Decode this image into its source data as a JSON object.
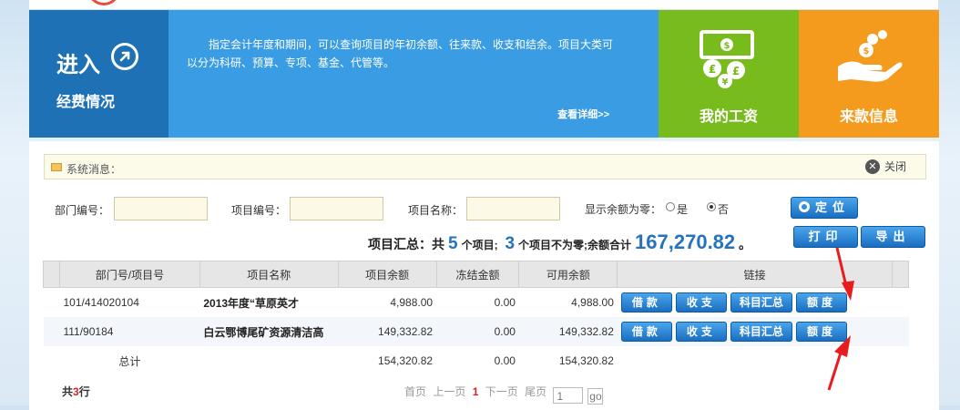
{
  "tiles": {
    "enter": {
      "title": "进入",
      "subtitle": "经费情况"
    },
    "info": {
      "description": "指定会计年度和期间，可以查询项目的年初余额、往来款、收支和结余。项目大类可以分为科研、预算、专项、基金、代管等。",
      "link": "查看详细>>"
    },
    "salary": {
      "label": "我的工资"
    },
    "income": {
      "label": "来款信息"
    }
  },
  "system_message": {
    "label": "系统消息：",
    "close_label": "关闭"
  },
  "filters": {
    "dept_label": "部门编号：",
    "dept_value": "",
    "project_no_label": "项目编号：",
    "project_no_value": "",
    "project_name_label": "项目名称：",
    "project_name_value": "",
    "zero_balance_label": "显示余额为零：",
    "option_yes": "是",
    "option_no": "否",
    "selected": "否",
    "locate_button": "定位"
  },
  "summary": {
    "prefix": "项目汇总：共",
    "project_count": "5",
    "count_unit": "个项目;",
    "nonzero_count": "3",
    "nonzero_text": "个项目不为零;余额合计",
    "balance_total": "167,270.82",
    "suffix": "。"
  },
  "actions": {
    "print": "打印",
    "export": "导出"
  },
  "table": {
    "headers": [
      "部门号/项目号",
      "项目名称",
      "项目余额",
      "冻结金额",
      "可用余额",
      "链接"
    ],
    "rows": [
      {
        "id": "101/414020104",
        "name": "2013年度“草原英才",
        "balance": "4,988.00",
        "frozen": "0.00",
        "available": "4,988.00"
      },
      {
        "id": "111/90184",
        "name": "白云鄂博尾矿资源清洁高",
        "balance": "149,332.82",
        "frozen": "0.00",
        "available": "149,332.82"
      }
    ],
    "row_buttons": [
      "借款",
      "收支",
      "科目汇总",
      "额度"
    ],
    "total": {
      "label": "总计",
      "balance": "154,320.82",
      "frozen": "0.00",
      "available": "154,320.82"
    }
  },
  "footer": {
    "count_prefix": "共",
    "count": "3",
    "count_suffix": "行",
    "pager": {
      "first": "首页",
      "prev": "上一页",
      "current": "1",
      "next": "下一页",
      "last": "尾页",
      "page_input": "1",
      "go": "go"
    }
  },
  "colors": {
    "tile_enter": "#1e71b4",
    "tile_info": "#3a9de3",
    "tile_salary": "#78bb1c",
    "tile_income": "#f49b1e",
    "accent_number": "#2573bd",
    "arrow": "#e81c1c"
  },
  "icons": {
    "enter": "arrow-circle-icon",
    "salary": "money-bill-icon",
    "income": "hand-coins-icon",
    "message": "mail-icon",
    "close": "close-icon",
    "locate": "target-icon"
  }
}
